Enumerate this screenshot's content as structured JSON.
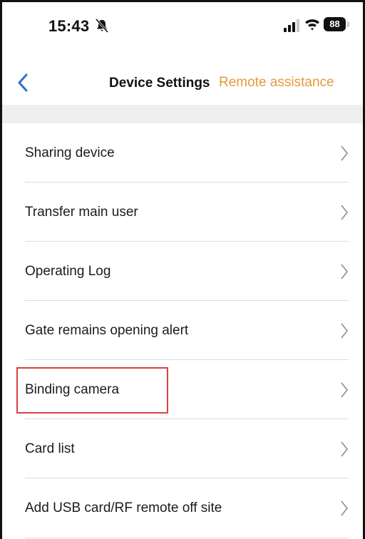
{
  "status_bar": {
    "time": "15:43",
    "battery": "88"
  },
  "nav": {
    "title": "Device Settings",
    "action": "Remote assistance"
  },
  "settings": [
    {
      "label": "Sharing device"
    },
    {
      "label": "Transfer main user"
    },
    {
      "label": "Operating Log"
    },
    {
      "label": "Gate remains opening alert"
    },
    {
      "label": "Binding camera",
      "highlighted": true
    },
    {
      "label": "Card list"
    },
    {
      "label": "Add USB card/RF remote off site"
    }
  ],
  "colors": {
    "accent": "#e69a3c",
    "highlight": "#d84242",
    "back_arrow": "#2f6fd1",
    "chevron": "#8c8c8c"
  }
}
